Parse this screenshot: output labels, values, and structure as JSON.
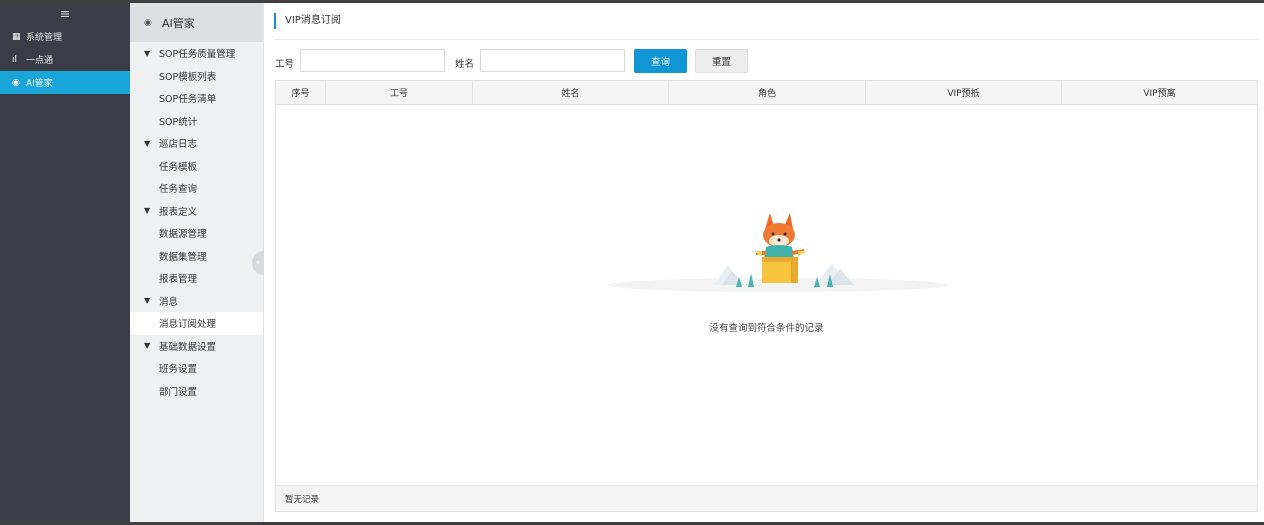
{
  "nav": {
    "toggle_icon": "hamburger-icon",
    "items": [
      {
        "label": "系统管理",
        "icon": "grid-icon"
      },
      {
        "label": "一点通",
        "icon": "bar-chart-icon"
      },
      {
        "label": "AI管家",
        "icon": "robot-icon"
      }
    ],
    "active_color": "#1aa5d8"
  },
  "submenu": {
    "header": "AI管家",
    "groups": [
      {
        "label": "SOP任务质量管理",
        "items": [
          "SOP模板列表",
          "SOP任务清单",
          "SOP统计"
        ]
      },
      {
        "label": "巡店日志",
        "items": [
          "任务模板",
          "任务查询"
        ]
      },
      {
        "label": "报表定义",
        "items": [
          "数据源管理",
          "数据集管理",
          "报表管理"
        ]
      },
      {
        "label": "消息",
        "items": [
          "消息订阅处理"
        ]
      },
      {
        "label": "基础数据设置",
        "items": [
          "班务设置",
          "部门设置"
        ]
      }
    ]
  },
  "main": {
    "title": "VIP消息订阅",
    "filters": {
      "employee_id_label": "工号",
      "employee_id_value": "",
      "name_label": "姓名",
      "name_value": ""
    },
    "buttons": {
      "search": "查询",
      "reset": "重置"
    },
    "table": {
      "columns": [
        "序号",
        "工号",
        "姓名",
        "角色",
        "VIP预抵",
        "VIP预离"
      ],
      "rows": [],
      "empty_text": "没有查询到符合条件的记录",
      "footer_text": "暂无记录"
    },
    "accent_color": "#1096d4"
  }
}
